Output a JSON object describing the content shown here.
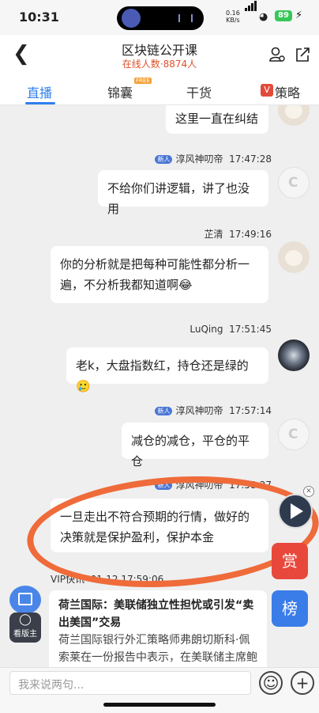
{
  "status_bar": {
    "time": "10:31",
    "speed": "0.16",
    "speed_unit": "KB/s",
    "battery": "89"
  },
  "header": {
    "title": "区块链公开课",
    "online_label": "在线人数",
    "online_count": "8874人"
  },
  "tabs": [
    {
      "label": "直播",
      "active": true
    },
    {
      "label": "锦囊",
      "badge": "FREE"
    },
    {
      "label": "干货"
    },
    {
      "label": "策略",
      "badge": "V"
    }
  ],
  "messages": [
    {
      "user": "",
      "time": "",
      "text": "这里一直在纠结"
    },
    {
      "badge": "新人",
      "user": "淳风神叨帝",
      "time": "17:47:28",
      "text": "不给你们讲逻辑，讲了也没用"
    },
    {
      "user": "芷清",
      "time": "17:49:16",
      "text": "你的分析就是把每种可能性都分析一遍，不分析我都知道啊😂"
    },
    {
      "user": "LuQing",
      "time": "17:51:45",
      "text": "老k，大盘指数红，持仓还是绿的🥲"
    },
    {
      "badge": "新人",
      "user": "淳风神叨帝",
      "time": "17:57:14",
      "text": "减仓的减仓，平仓的平仓"
    },
    {
      "badge": "新人",
      "user": "淳风神叨帝",
      "time": "17:58:27",
      "text": "一旦走出不符合预期的行情，做好的决策就是保护盈利，保护本金"
    }
  ],
  "vip_news": {
    "label": "VIP快讯",
    "time": "01-12 17:59:06",
    "headline": "荷兰国际：美联储独立性担忧或引发“卖出美国”交易",
    "body": "荷兰国际银行外汇策略师弗朗切斯科·佩索莱在一份报告中表示，在美联储主席鲍"
  },
  "side_buttons": {
    "reward": "赏",
    "rank": "榜",
    "host": "看版主"
  },
  "input": {
    "placeholder": "我来说两句..."
  },
  "icons": [
    "back-icon",
    "user-settings-icon",
    "share-icon",
    "emoji-icon",
    "plus-icon",
    "play-icon",
    "close-icon"
  ],
  "colors": {
    "accent": "#2f80ed",
    "online": "#e0512b",
    "annotation": "#ef6b3a",
    "reward": "#e8483b",
    "rank": "#3b7de8"
  }
}
